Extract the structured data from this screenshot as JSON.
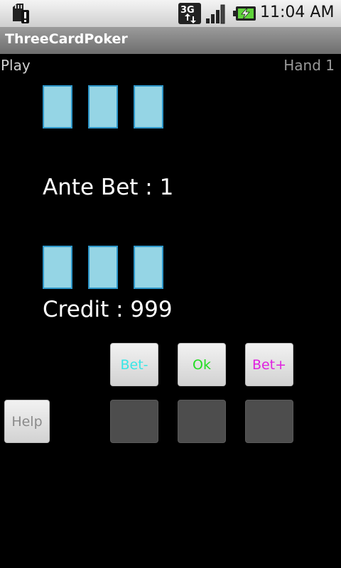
{
  "status_bar": {
    "time": "11:04 AM",
    "network": "3G",
    "icons": [
      "sd-card-alert-icon",
      "network-3g-icon",
      "signal-icon",
      "battery-charging-icon"
    ]
  },
  "app": {
    "title": "ThreeCardPoker"
  },
  "game": {
    "play_label": "Play",
    "hand_label": "Hand 1",
    "ante_bet_text": "Ante Bet : 1",
    "credit_text": "Credit : 999"
  },
  "buttons": {
    "bet_minus": "Bet-",
    "ok": "Ok",
    "bet_plus": "Bet+",
    "help": "Help"
  },
  "colors": {
    "bet_minus": "#38e6e6",
    "ok": "#22dd22",
    "bet_plus": "#e020e0",
    "help": "#8a8a8a",
    "card_fill": "#95d5e5",
    "card_border": "#2c95c8"
  }
}
